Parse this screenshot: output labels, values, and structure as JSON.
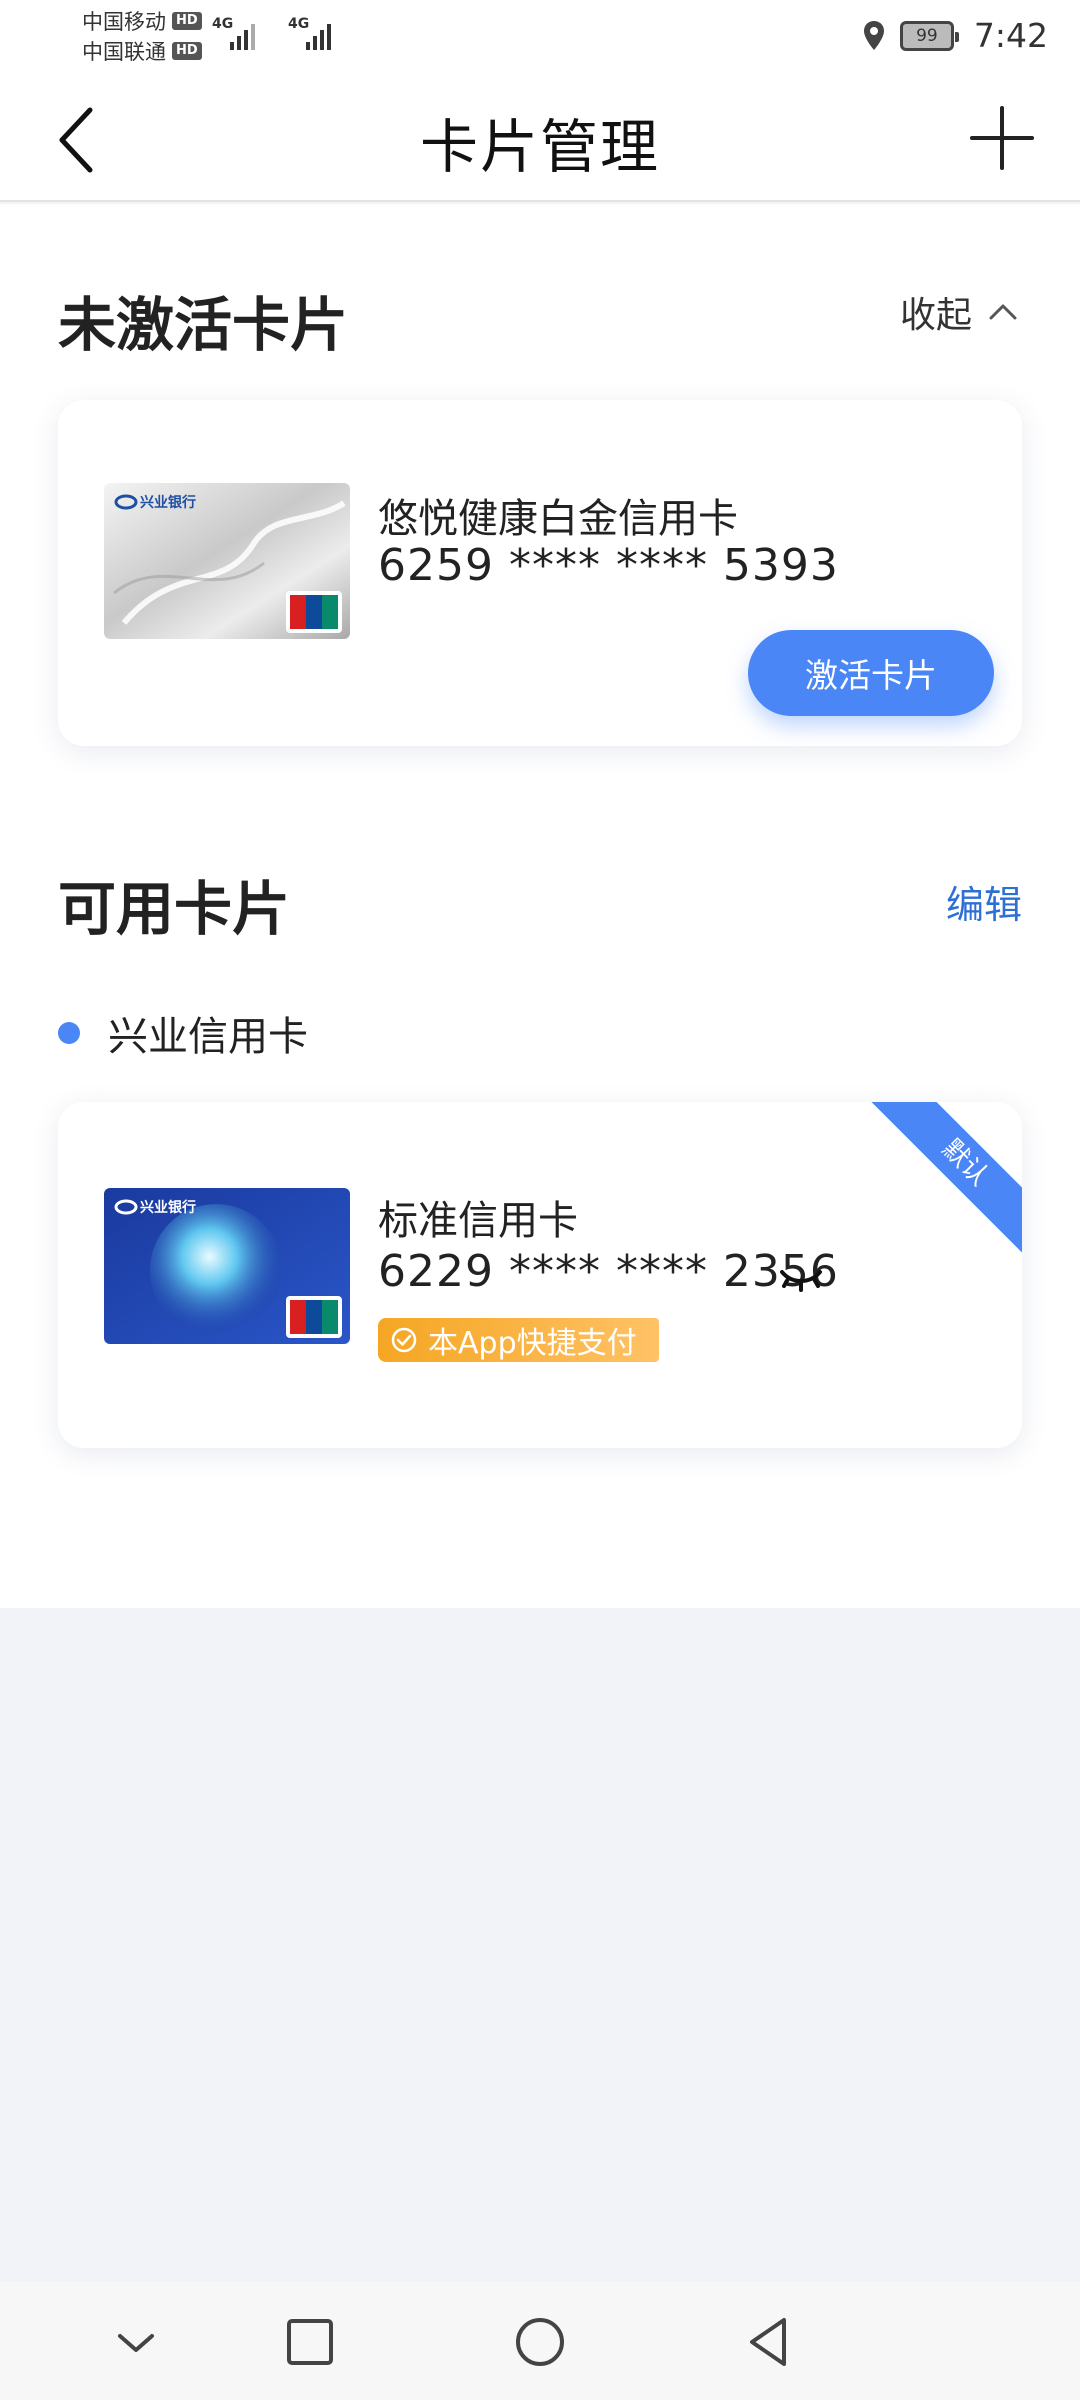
{
  "status_bar": {
    "carrier1": "中国移动",
    "carrier2": "中国联通",
    "hd": "HD",
    "network": "4G",
    "battery": "99",
    "time": "7:42"
  },
  "nav": {
    "title": "卡片管理"
  },
  "inactive_section": {
    "title": "未激活卡片",
    "collapse_label": "收起",
    "card": {
      "bank_name": "兴业银行",
      "name": "悠悦健康白金信用卡",
      "number": "6259 **** **** 5393",
      "activate_label": "激活卡片"
    }
  },
  "available_section": {
    "title": "可用卡片",
    "edit_label": "编辑",
    "group_label": "兴业信用卡",
    "card": {
      "bank_name": "兴业银行",
      "name": "标准信用卡",
      "number": "6229 **** **** 2356",
      "default_label": "默认",
      "quickpay_label": "本App快捷支付"
    }
  },
  "colors": {
    "accent": "#4a86f6",
    "link": "#2e6fd6",
    "badge": "#f5a623",
    "page_bg": "#f2f3f8"
  }
}
